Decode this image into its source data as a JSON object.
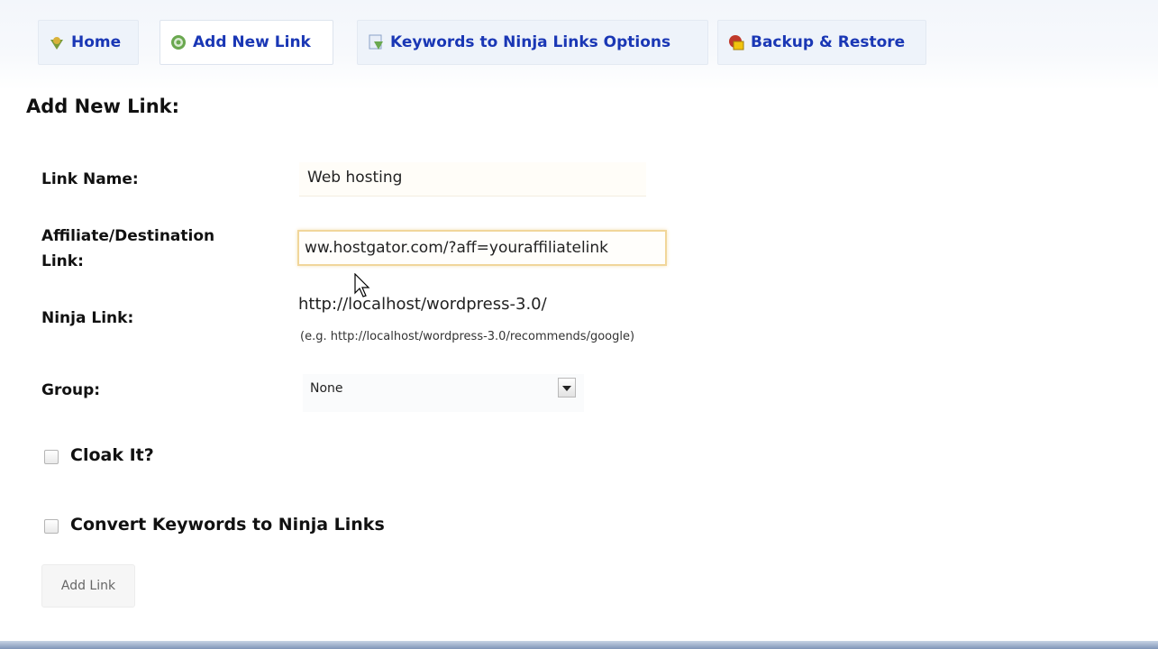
{
  "tabs": [
    {
      "id": "home",
      "label": "Home",
      "icon": "home-icon"
    },
    {
      "id": "add-new-link",
      "label": "Add New Link",
      "icon": "add-link-icon",
      "active": true
    },
    {
      "id": "keywords",
      "label": "Keywords to Ninja Links Options",
      "icon": "keywords-icon"
    },
    {
      "id": "backup",
      "label": "Backup & Restore",
      "icon": "backup-icon"
    }
  ],
  "page": {
    "title": "Add New Link:"
  },
  "form": {
    "link_name": {
      "label": "Link Name:",
      "value": "Web hosting"
    },
    "affiliate": {
      "label_line1": "Affiliate/Destination",
      "label_line2": "Link:",
      "value": "ww.hostgator.com/?aff=youraffiliatelink"
    },
    "ninja_link": {
      "label": "Ninja Link:",
      "base_url": "http://localhost/wordpress-3.0/",
      "hint": "(e.g. http://localhost/wordpress-3.0/recommends/google)"
    },
    "group": {
      "label": "Group:",
      "selected": "None"
    },
    "cloak": {
      "label": "Cloak It?",
      "checked": false
    },
    "convert_keywords": {
      "label": "Convert Keywords to Ninja Links",
      "checked": false
    },
    "submit": {
      "label": "Add Link"
    }
  },
  "colors": {
    "tab_text": "#1a37b5",
    "input_focus_border": "#f1d69a"
  }
}
